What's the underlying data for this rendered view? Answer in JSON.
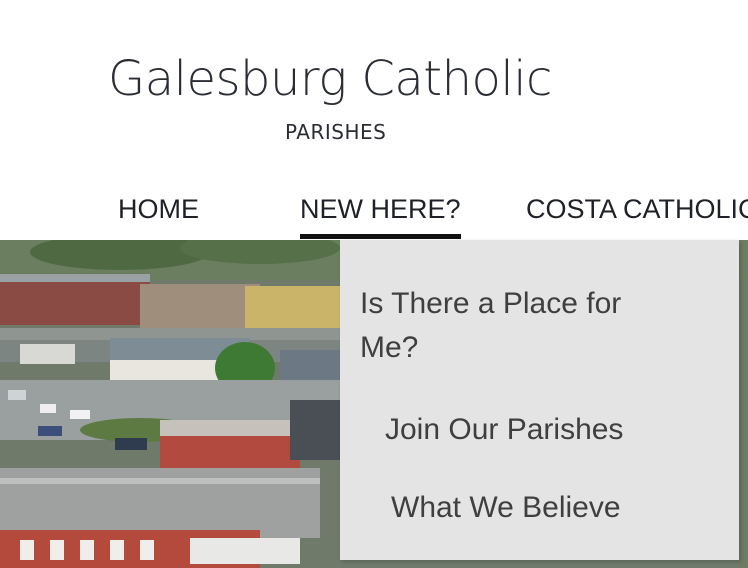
{
  "site": {
    "title": "Galesburg Catholic",
    "subtitle": "PARISHES"
  },
  "nav": {
    "items": [
      {
        "label": "HOME"
      },
      {
        "label": "NEW HERE?",
        "active": true
      },
      {
        "label": "COSTA CATHOLIC"
      }
    ]
  },
  "dropdown": {
    "items": [
      {
        "label_line1": "Is There a Place for",
        "label_line2": "Me?"
      },
      {
        "label": "Join Our Parishes"
      },
      {
        "label": "What We Believe"
      }
    ]
  },
  "hero": {
    "image": "aerial photo of town with railroad tracks and buildings"
  }
}
